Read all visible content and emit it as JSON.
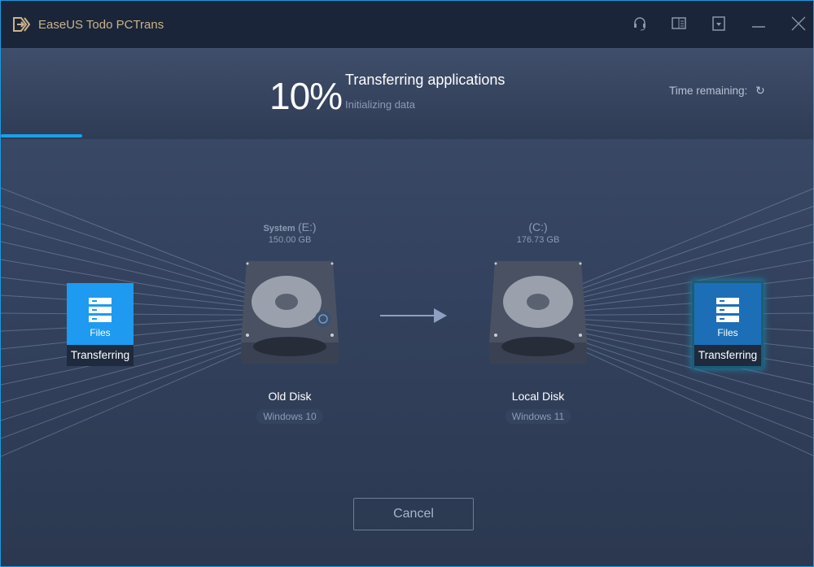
{
  "app": {
    "title": "EaseUS Todo PCTrans",
    "accent": "#1aa0ea"
  },
  "titlebar_icons": [
    "headset-icon",
    "book-icon",
    "download-icon",
    "minimize-icon",
    "close-icon"
  ],
  "header": {
    "percent_text": "10%",
    "progress": 0.1,
    "status": "Transferring applications",
    "substatus": "Initializing data",
    "time_remaining_label": "Time remaining:"
  },
  "source": {
    "card_label": "Files",
    "card_status": "Transferring",
    "drive_name": "System",
    "drive_letter": "(E:)",
    "size": "150.00 GB",
    "disk_name": "Old Disk",
    "os": "Windows 10"
  },
  "target": {
    "card_label": "Files",
    "card_status": "Transferring",
    "drive_letter": "(C:)",
    "size": "176.73 GB",
    "disk_name": "Local Disk",
    "os": "Windows 11"
  },
  "actions": {
    "cancel": "Cancel"
  }
}
